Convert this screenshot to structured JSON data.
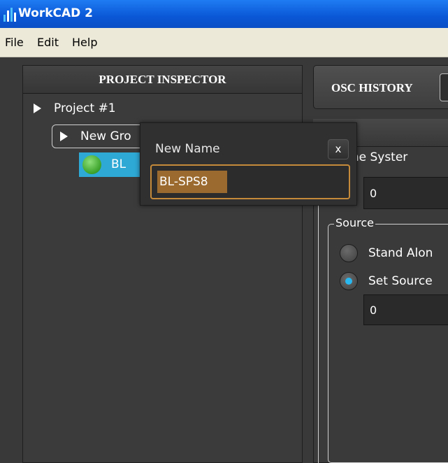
{
  "app": {
    "title": "WorkCAD 2",
    "icon": "bar-chart-icon"
  },
  "menu": {
    "items": [
      {
        "label": "File"
      },
      {
        "label": "Edit"
      },
      {
        "label": "Help"
      }
    ]
  },
  "inspector": {
    "header": "PROJECT INSPECTOR",
    "project_label": "Project #1",
    "group_label": "New Gro",
    "device_label": "BL"
  },
  "osc": {
    "label": "OSC HISTORY"
  },
  "right_panel": {
    "system_label": "ue Line Syster",
    "field_label": "e",
    "field_value": "0",
    "source_legend": "Source",
    "option_stand_alone": "Stand Alon",
    "option_set_source": "Set Source",
    "source_value": "0"
  },
  "rename_popup": {
    "title": "New Name",
    "close_label": "x",
    "input_value": "BL-SPS8"
  },
  "colors": {
    "accent": "#2ea8d5",
    "input_highlight": "#c58a3a",
    "titlebar": "#0a57d6"
  }
}
